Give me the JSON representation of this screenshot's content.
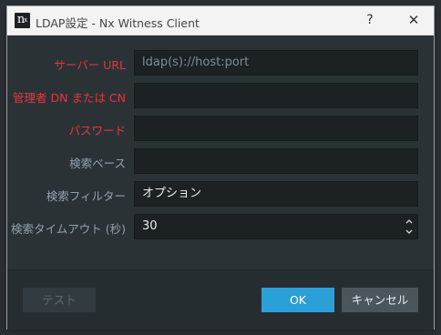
{
  "window": {
    "title": "LDAP設定 - Nx Witness Client",
    "logo": "n",
    "logo_sup": "x",
    "help": "?",
    "close": "✕"
  },
  "form": {
    "server_url_label": "サーバー URL",
    "server_url_placeholder": "ldap(s)://host:port",
    "admin_dn_label": "管理者 DN または CN",
    "admin_dn_value": "",
    "password_label": "パスワード",
    "password_value": "",
    "search_base_label": "検索ベース",
    "search_base_value": "",
    "search_filter_label": "検索フィルター",
    "search_filter_placeholder": "オプション",
    "search_timeout_label": "検索タイムアウト (秒)",
    "search_timeout_value": "30"
  },
  "footer": {
    "test_label": "テスト",
    "ok_label": "OK",
    "cancel_label": "キャンセル"
  },
  "colors": {
    "required_label": "#e5363c",
    "accent": "#2a9fd8"
  }
}
